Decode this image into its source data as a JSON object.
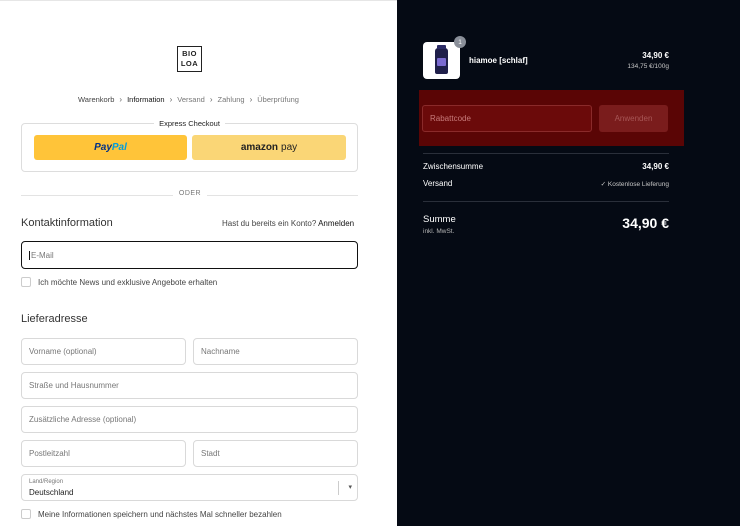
{
  "logo": {
    "line1": "BIO",
    "line2": "LOA"
  },
  "breadcrumb": [
    {
      "label": "Warenkorb",
      "state": "done"
    },
    {
      "label": "Information",
      "state": "active"
    },
    {
      "label": "Versand",
      "state": "upcoming"
    },
    {
      "label": "Zahlung",
      "state": "upcoming"
    },
    {
      "label": "Überprüfung",
      "state": "upcoming"
    }
  ],
  "express": {
    "title": "Express Checkout",
    "paypal_a": "Pay",
    "paypal_b": "Pal",
    "amazon_a": "amazon",
    "amazon_b": "pay"
  },
  "or_label": "ODER",
  "contact": {
    "title": "Kontaktinformation",
    "account_prompt": "Hast du bereits ein Konto?",
    "login_link": "Anmelden",
    "email_placeholder": "E-Mail",
    "news_checkbox": "Ich möchte News und exklusive Angebote erhalten"
  },
  "shipping": {
    "title": "Lieferadresse",
    "firstname_placeholder": "Vorname (optional)",
    "lastname_placeholder": "Nachname",
    "street_placeholder": "Straße und Hausnummer",
    "address2_placeholder": "Zusätzliche Adresse (optional)",
    "zip_placeholder": "Postleitzahl",
    "city_placeholder": "Stadt",
    "country_label": "Land/Region",
    "country_value": "Deutschland",
    "save_checkbox": "Meine Informationen speichern und nächstes Mal schneller bezahlen"
  },
  "summary": {
    "product": {
      "name": "hiamoe [schlaf]",
      "quantity": "1",
      "price": "34,90 €",
      "unit_price": "134,75 €/100g"
    },
    "discount_placeholder": "Rabattcode",
    "discount_button": "Anwenden",
    "subtotal_label": "Zwischensumme",
    "subtotal_value": "34,90 €",
    "shipping_label": "Versand",
    "shipping_value": "✓ Kostenlose Lieferung",
    "total_label": "Summe",
    "total_sub": "inkl. MwSt.",
    "total_value": "34,90 €"
  },
  "colors": {
    "paypal_yellow": "#ffc439",
    "amazon_yellow": "#fad676",
    "summary_bg": "#050a14",
    "discount_highlight": "#5a0505"
  }
}
